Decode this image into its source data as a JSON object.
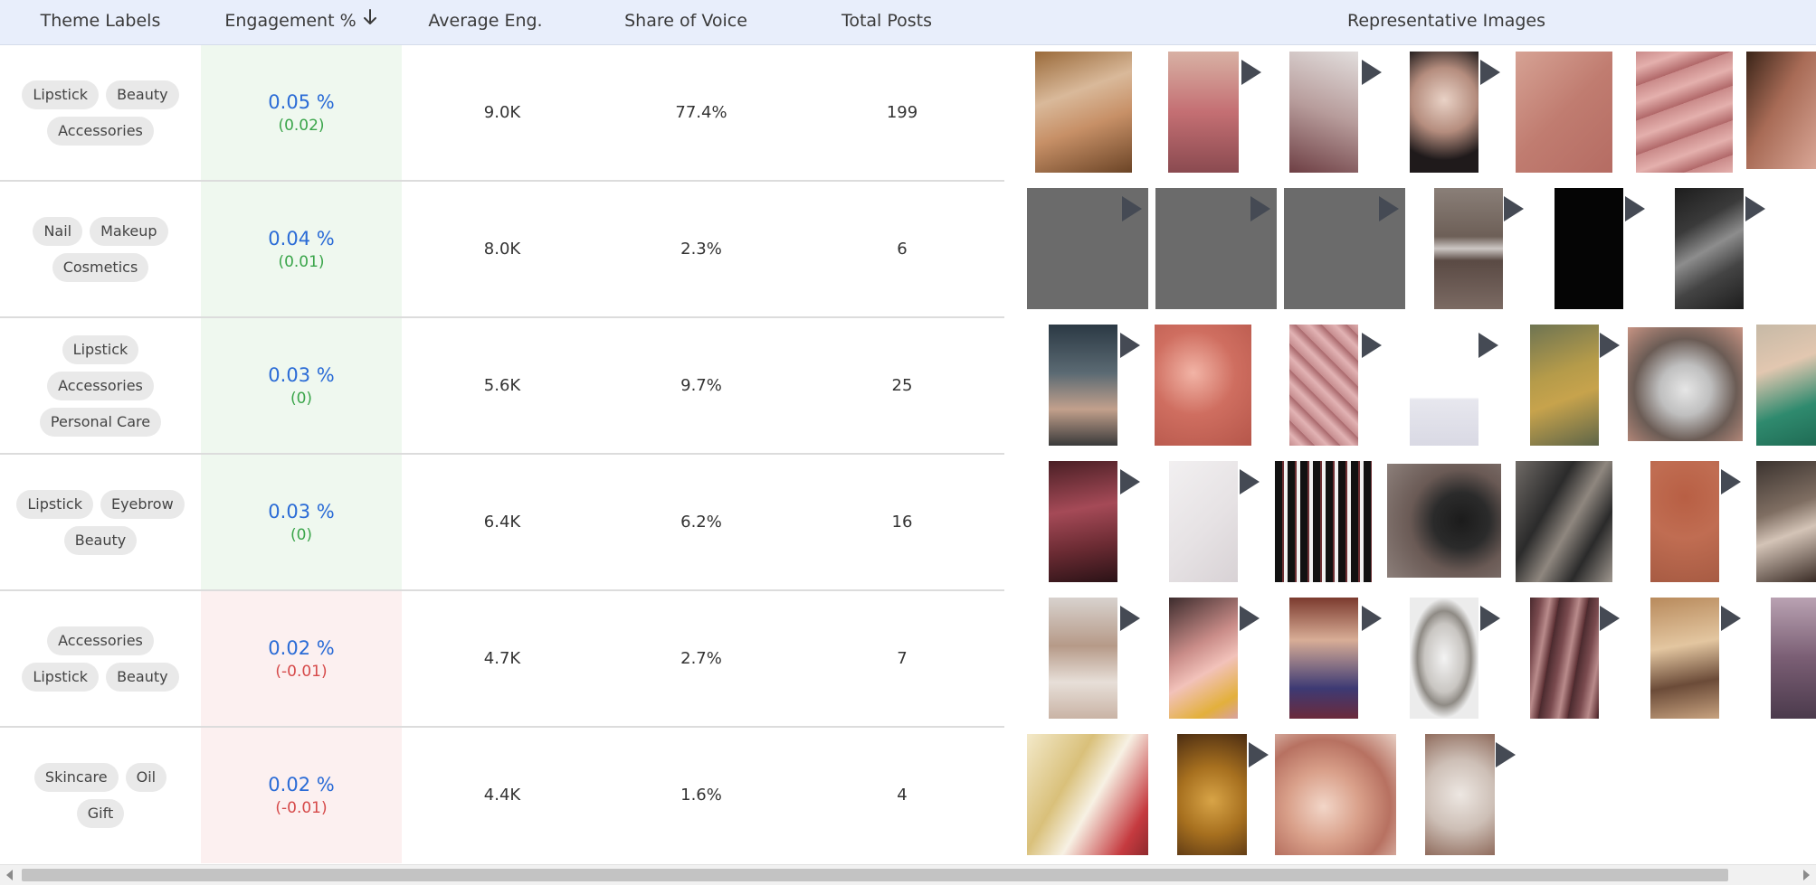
{
  "header": {
    "theme_labels": "Theme Labels",
    "engagement": "Engagement %",
    "average_eng": "Average Eng.",
    "share_of_voice": "Share of Voice",
    "total_posts": "Total Posts",
    "representative_images": "Representative Images"
  },
  "rows": [
    {
      "tags": [
        "Lipstick",
        "Beauty",
        "Accessories"
      ],
      "engagement": "0.05 %",
      "delta": "(0.02)",
      "trend": "positive",
      "average_eng": "9.0K",
      "share_of_voice": "77.4%",
      "total_posts": "199"
    },
    {
      "tags": [
        "Nail",
        "Makeup",
        "Cosmetics"
      ],
      "engagement": "0.04 %",
      "delta": "(0.01)",
      "trend": "positive",
      "average_eng": "8.0K",
      "share_of_voice": "2.3%",
      "total_posts": "6"
    },
    {
      "tags": [
        "Lipstick",
        "Accessories",
        "Personal Care"
      ],
      "engagement": "0.03 %",
      "delta": "(0)",
      "trend": "positive",
      "average_eng": "5.6K",
      "share_of_voice": "9.7%",
      "total_posts": "25"
    },
    {
      "tags": [
        "Lipstick",
        "Eyebrow",
        "Beauty"
      ],
      "engagement": "0.03 %",
      "delta": "(0)",
      "trend": "positive",
      "average_eng": "6.4K",
      "share_of_voice": "6.2%",
      "total_posts": "16"
    },
    {
      "tags": [
        "Accessories",
        "Lipstick",
        "Beauty"
      ],
      "engagement": "0.02 %",
      "delta": "(-0.01)",
      "trend": "negative",
      "average_eng": "4.7K",
      "share_of_voice": "2.7%",
      "total_posts": "7"
    },
    {
      "tags": [
        "Skincare",
        "Oil",
        "Gift"
      ],
      "engagement": "0.02 %",
      "delta": "(-0.01)",
      "trend": "negative",
      "average_eng": "4.4K",
      "share_of_voice": "1.6%",
      "total_posts": "4"
    }
  ],
  "colors": {
    "header_bg": "#e8eefb",
    "positive_bg": "#eff8ef",
    "negative_bg": "#fcf0f0",
    "engagement_text": "#2a6bd6",
    "positive_text": "#3aa54a",
    "negative_text": "#d64a4a",
    "play_icon": "#454a54"
  },
  "icons": {
    "sort": "arrow-down-icon",
    "video": "play-icon",
    "scroll_left": "chevron-left-icon",
    "scroll_right": "chevron-right-icon"
  }
}
